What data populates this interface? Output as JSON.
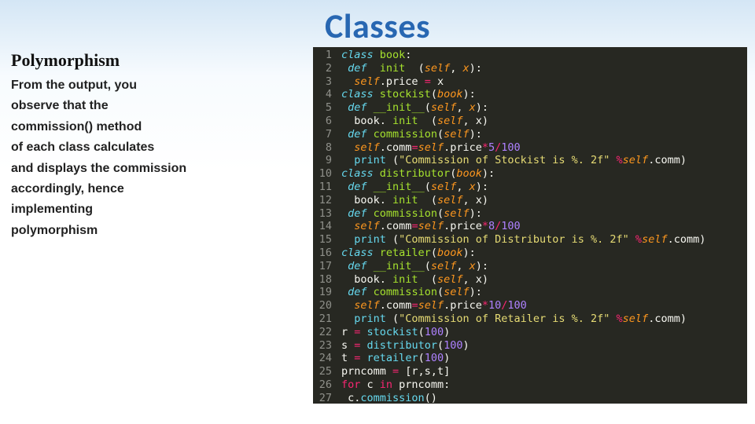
{
  "title": "Classes",
  "subheading": "Polymorphism",
  "paragraph": "From the output, you\nobserve that the\ncommission() method\nof each class calculates\nand displays the commission\naccordingly, hence\nimplementing\npolymorphism",
  "code": {
    "line_count": 27,
    "tokens": [
      [
        [
          "kw",
          "class"
        ],
        [
          "pl",
          " "
        ],
        [
          "cls",
          "book"
        ],
        [
          "pl",
          ":"
        ]
      ],
      [
        [
          "pl",
          " "
        ],
        [
          "kw",
          "def"
        ],
        [
          "pl",
          "  "
        ],
        [
          "fn",
          "init"
        ],
        [
          "pl",
          "  ("
        ],
        [
          "self",
          "self"
        ],
        [
          "pl",
          ", "
        ],
        [
          "param",
          "x"
        ],
        [
          "pl",
          "):"
        ]
      ],
      [
        [
          "pl",
          "  "
        ],
        [
          "self",
          "self"
        ],
        [
          "pl",
          "."
        ],
        [
          "pl",
          "price "
        ],
        [
          "op",
          "="
        ],
        [
          "pl",
          " x"
        ]
      ],
      [
        [
          "kw",
          "class"
        ],
        [
          "pl",
          " "
        ],
        [
          "cls",
          "stockist"
        ],
        [
          "pl",
          "("
        ],
        [
          "param",
          "book"
        ],
        [
          "pl",
          "):"
        ]
      ],
      [
        [
          "pl",
          " "
        ],
        [
          "kw",
          "def"
        ],
        [
          "pl",
          " "
        ],
        [
          "fn",
          "__init__"
        ],
        [
          "pl",
          "("
        ],
        [
          "self",
          "self"
        ],
        [
          "pl",
          ", "
        ],
        [
          "param",
          "x"
        ],
        [
          "pl",
          "):"
        ]
      ],
      [
        [
          "pl",
          "  "
        ],
        [
          "pl",
          "book."
        ],
        [
          "pl",
          " "
        ],
        [
          "fn",
          "init"
        ],
        [
          "pl",
          "  ("
        ],
        [
          "self",
          "self"
        ],
        [
          "pl",
          ", x)"
        ]
      ],
      [
        [
          "pl",
          " "
        ],
        [
          "kw",
          "def"
        ],
        [
          "pl",
          " "
        ],
        [
          "fn",
          "commission"
        ],
        [
          "pl",
          "("
        ],
        [
          "self",
          "self"
        ],
        [
          "pl",
          "):"
        ]
      ],
      [
        [
          "pl",
          "  "
        ],
        [
          "self",
          "self"
        ],
        [
          "pl",
          "."
        ],
        [
          "pl",
          "comm"
        ],
        [
          "op",
          "="
        ],
        [
          "self",
          "self"
        ],
        [
          "pl",
          "."
        ],
        [
          "pl",
          "price"
        ],
        [
          "op",
          "*"
        ],
        [
          "num",
          "5"
        ],
        [
          "op",
          "/"
        ],
        [
          "num",
          "100"
        ]
      ],
      [
        [
          "pl",
          "  "
        ],
        [
          "call",
          "print"
        ],
        [
          "pl",
          " ("
        ],
        [
          "str",
          "\"Commission of Stockist is %. 2f\""
        ],
        [
          "pl",
          " "
        ],
        [
          "op",
          "%"
        ],
        [
          "self",
          "self"
        ],
        [
          "pl",
          ".comm)"
        ]
      ],
      [
        [
          "kw",
          "class"
        ],
        [
          "pl",
          " "
        ],
        [
          "cls",
          "distributor"
        ],
        [
          "pl",
          "("
        ],
        [
          "param",
          "book"
        ],
        [
          "pl",
          "):"
        ]
      ],
      [
        [
          "pl",
          " "
        ],
        [
          "kw",
          "def"
        ],
        [
          "pl",
          " "
        ],
        [
          "fn",
          "__init__"
        ],
        [
          "pl",
          "("
        ],
        [
          "self",
          "self"
        ],
        [
          "pl",
          ", "
        ],
        [
          "param",
          "x"
        ],
        [
          "pl",
          "):"
        ]
      ],
      [
        [
          "pl",
          "  "
        ],
        [
          "pl",
          "book."
        ],
        [
          "pl",
          " "
        ],
        [
          "fn",
          "init"
        ],
        [
          "pl",
          "  ("
        ],
        [
          "self",
          "self"
        ],
        [
          "pl",
          ", x)"
        ]
      ],
      [
        [
          "pl",
          " "
        ],
        [
          "kw",
          "def"
        ],
        [
          "pl",
          " "
        ],
        [
          "fn",
          "commission"
        ],
        [
          "pl",
          "("
        ],
        [
          "self",
          "self"
        ],
        [
          "pl",
          "):"
        ]
      ],
      [
        [
          "pl",
          "  "
        ],
        [
          "self",
          "self"
        ],
        [
          "pl",
          "."
        ],
        [
          "pl",
          "comm"
        ],
        [
          "op",
          "="
        ],
        [
          "self",
          "self"
        ],
        [
          "pl",
          "."
        ],
        [
          "pl",
          "price"
        ],
        [
          "op",
          "*"
        ],
        [
          "num",
          "8"
        ],
        [
          "op",
          "/"
        ],
        [
          "num",
          "100"
        ]
      ],
      [
        [
          "pl",
          "  "
        ],
        [
          "call",
          "print"
        ],
        [
          "pl",
          " ("
        ],
        [
          "str",
          "\"Commission of Distributor is %. 2f\""
        ],
        [
          "pl",
          " "
        ],
        [
          "op",
          "%"
        ],
        [
          "self",
          "self"
        ],
        [
          "pl",
          ".comm)"
        ]
      ],
      [
        [
          "kw",
          "class"
        ],
        [
          "pl",
          " "
        ],
        [
          "cls",
          "retailer"
        ],
        [
          "pl",
          "("
        ],
        [
          "param",
          "book"
        ],
        [
          "pl",
          "):"
        ]
      ],
      [
        [
          "pl",
          " "
        ],
        [
          "kw",
          "def"
        ],
        [
          "pl",
          " "
        ],
        [
          "fn",
          "__init__"
        ],
        [
          "pl",
          "("
        ],
        [
          "self",
          "self"
        ],
        [
          "pl",
          ", "
        ],
        [
          "param",
          "x"
        ],
        [
          "pl",
          "):"
        ]
      ],
      [
        [
          "pl",
          "  "
        ],
        [
          "pl",
          "book."
        ],
        [
          "pl",
          " "
        ],
        [
          "fn",
          "init"
        ],
        [
          "pl",
          "  ("
        ],
        [
          "self",
          "self"
        ],
        [
          "pl",
          ", x)"
        ]
      ],
      [
        [
          "pl",
          " "
        ],
        [
          "kw",
          "def"
        ],
        [
          "pl",
          " "
        ],
        [
          "fn",
          "commission"
        ],
        [
          "pl",
          "("
        ],
        [
          "self",
          "self"
        ],
        [
          "pl",
          "):"
        ]
      ],
      [
        [
          "pl",
          "  "
        ],
        [
          "self",
          "self"
        ],
        [
          "pl",
          "."
        ],
        [
          "pl",
          "comm"
        ],
        [
          "op",
          "="
        ],
        [
          "self",
          "self"
        ],
        [
          "pl",
          "."
        ],
        [
          "pl",
          "price"
        ],
        [
          "op",
          "*"
        ],
        [
          "num",
          "10"
        ],
        [
          "op",
          "/"
        ],
        [
          "num",
          "100"
        ]
      ],
      [
        [
          "pl",
          "  "
        ],
        [
          "call",
          "print"
        ],
        [
          "pl",
          " ("
        ],
        [
          "str",
          "\"Commission of Retailer is %. 2f\""
        ],
        [
          "pl",
          " "
        ],
        [
          "op",
          "%"
        ],
        [
          "self",
          "self"
        ],
        [
          "pl",
          ".comm)"
        ]
      ],
      [
        [
          "pl",
          "r "
        ],
        [
          "op",
          "="
        ],
        [
          "pl",
          " "
        ],
        [
          "call",
          "stockist"
        ],
        [
          "pl",
          "("
        ],
        [
          "num",
          "100"
        ],
        [
          "pl",
          ")"
        ]
      ],
      [
        [
          "pl",
          "s "
        ],
        [
          "op",
          "="
        ],
        [
          "pl",
          " "
        ],
        [
          "call",
          "distributor"
        ],
        [
          "pl",
          "("
        ],
        [
          "num",
          "100"
        ],
        [
          "pl",
          ")"
        ]
      ],
      [
        [
          "pl",
          "t "
        ],
        [
          "op",
          "="
        ],
        [
          "pl",
          " "
        ],
        [
          "call",
          "retailer"
        ],
        [
          "pl",
          "("
        ],
        [
          "num",
          "100"
        ],
        [
          "pl",
          ")"
        ]
      ],
      [
        [
          "pl",
          "prncomm "
        ],
        [
          "op",
          "="
        ],
        [
          "pl",
          " [r,s,t]"
        ]
      ],
      [
        [
          "op",
          "for"
        ],
        [
          "pl",
          " c "
        ],
        [
          "op",
          "in"
        ],
        [
          "pl",
          " prncomm:"
        ]
      ],
      [
        [
          "pl",
          " c."
        ],
        [
          "call",
          "commission"
        ],
        [
          "pl",
          "()"
        ]
      ]
    ]
  }
}
